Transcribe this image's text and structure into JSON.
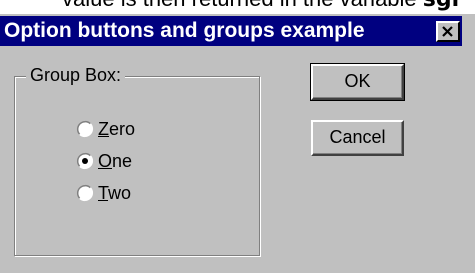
{
  "partial_text": {
    "text": "value is then returned in the variable ",
    "bold_text": "sgr"
  },
  "window": {
    "title": "Option buttons and groups example",
    "close_label": "close-icon"
  },
  "group_box": {
    "label": "Group Box:",
    "options": [
      {
        "label": "Zero",
        "mnemonic": "Z",
        "rest": "ero",
        "selected": false
      },
      {
        "label": "One",
        "mnemonic": "O",
        "rest": "ne",
        "selected": true
      },
      {
        "label": "Two",
        "mnemonic": "T",
        "rest": "wo",
        "selected": false
      }
    ]
  },
  "buttons": {
    "ok_label": "OK",
    "cancel_label": "Cancel"
  },
  "colors": {
    "title_bar": "#000080",
    "dialog_bg": "#c0c0c0"
  }
}
